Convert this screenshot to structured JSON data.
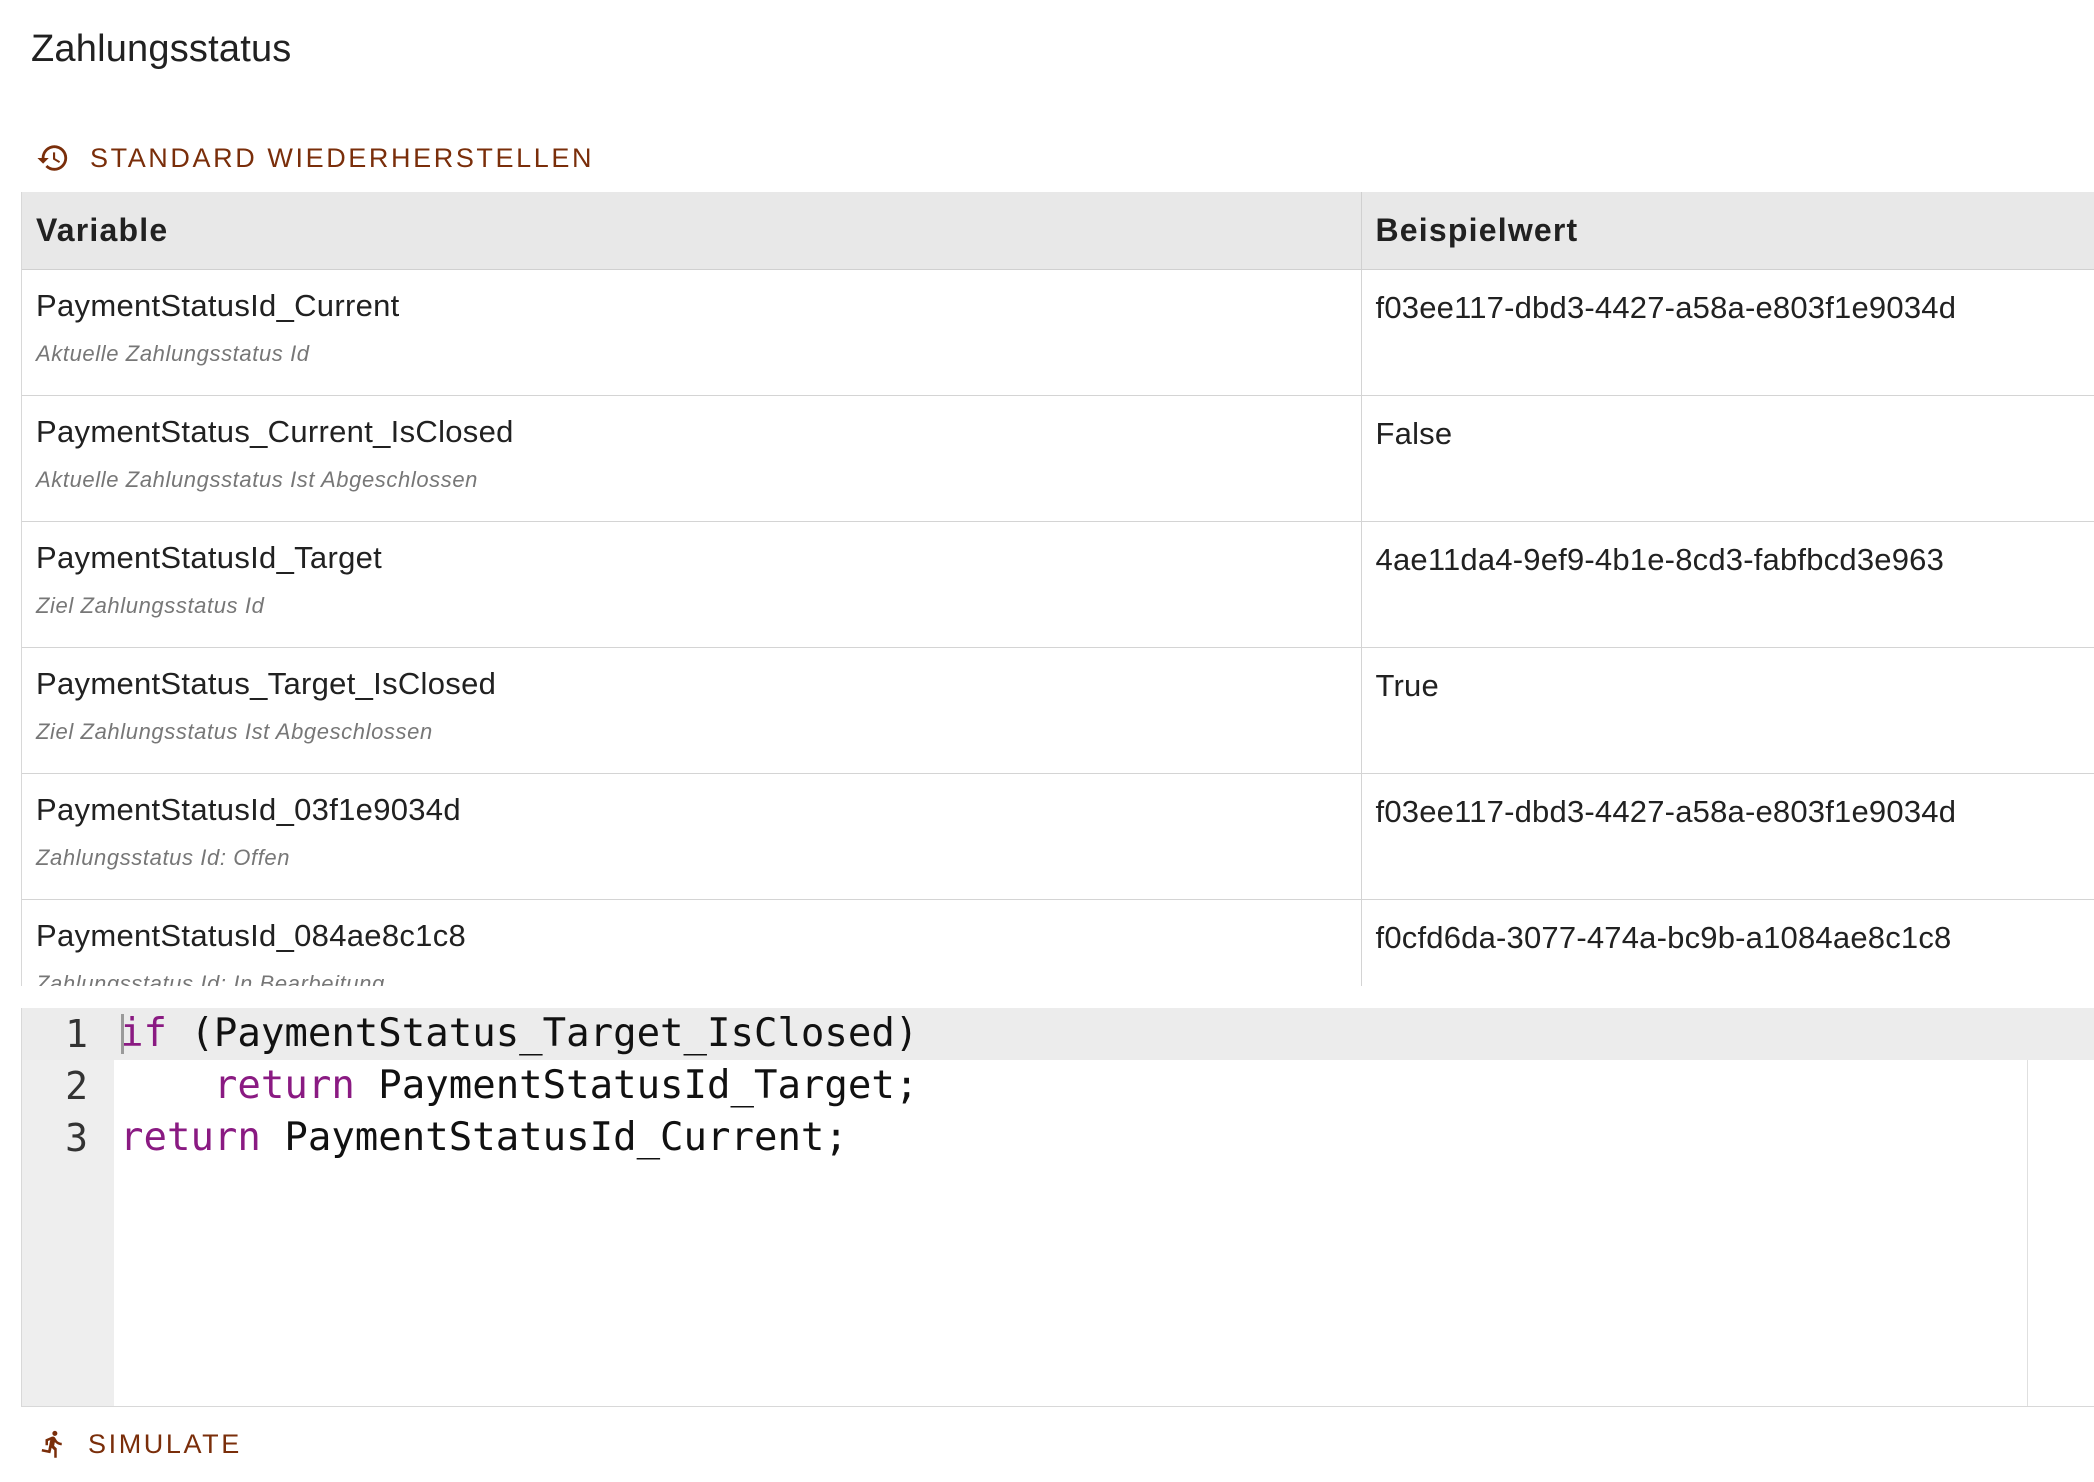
{
  "header": {
    "title": "Zahlungsstatus"
  },
  "actions": {
    "restore_label": "STANDARD WIEDERHERSTELLEN",
    "simulate_label": "SIMULATE",
    "restore_icon": "history-icon",
    "simulate_icon": "run-icon",
    "accent_color": "#7a2e0a"
  },
  "table": {
    "columns": [
      "Variable",
      "Beispielwert"
    ],
    "rows": [
      {
        "name": "PaymentStatusId_Current",
        "description": "Aktuelle Zahlungsstatus Id",
        "value": "f03ee117-dbd3-4427-a58a-e803f1e9034d"
      },
      {
        "name": "PaymentStatus_Current_IsClosed",
        "description": "Aktuelle Zahlungsstatus Ist Abgeschlossen",
        "value": "False"
      },
      {
        "name": "PaymentStatusId_Target",
        "description": "Ziel Zahlungsstatus Id",
        "value": "4ae11da4-9ef9-4b1e-8cd3-fabfbcd3e963"
      },
      {
        "name": "PaymentStatus_Target_IsClosed",
        "description": "Ziel Zahlungsstatus Ist Abgeschlossen",
        "value": "True"
      },
      {
        "name": "PaymentStatusId_03f1e9034d",
        "description": "Zahlungsstatus Id: Offen",
        "value": "f03ee117-dbd3-4427-a58a-e803f1e9034d"
      },
      {
        "name": "PaymentStatusId_084ae8c1c8",
        "description": "Zahlungsstatus Id: In Bearbeitung",
        "value": "f0cfd6da-3077-474a-bc9b-a1084ae8c1c8"
      }
    ]
  },
  "editor": {
    "lines": [
      {
        "num": "1",
        "indent": "",
        "kw": "if",
        "rest": " (PaymentStatus_Target_IsClosed)"
      },
      {
        "num": "2",
        "indent": "    ",
        "kw": "return",
        "rest": " PaymentStatusId_Target;"
      },
      {
        "num": "3",
        "indent": "",
        "kw": "return",
        "rest": " PaymentStatusId_Current;"
      }
    ]
  }
}
